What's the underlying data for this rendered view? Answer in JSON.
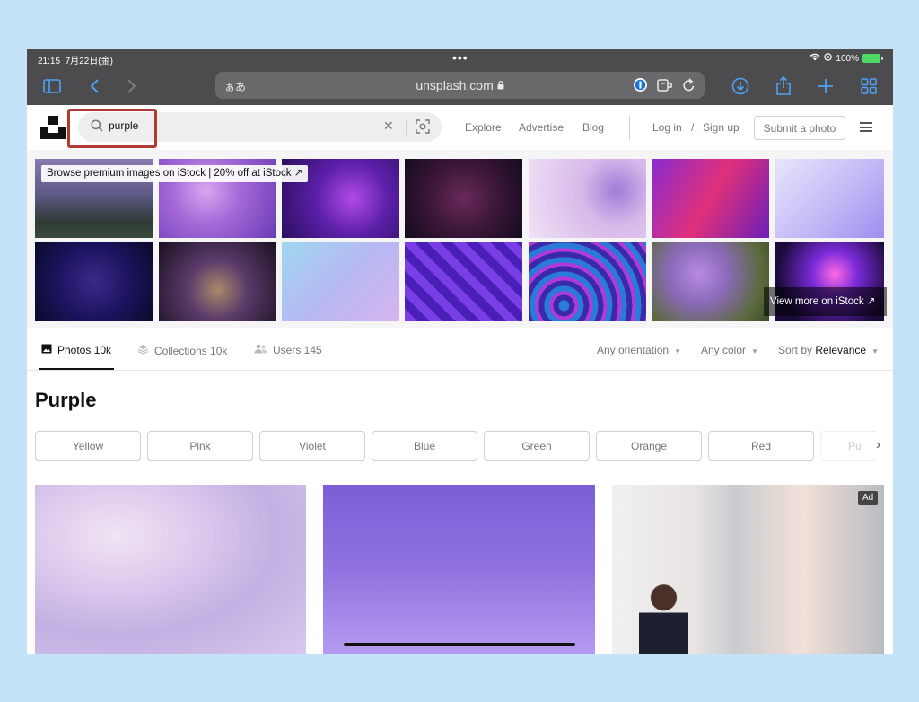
{
  "status": {
    "time": "21:15",
    "date": "7月22日(金)",
    "battery": "100%"
  },
  "browser": {
    "reader_label": "ぁあ",
    "url": "unsplash.com"
  },
  "header": {
    "search_value": "purple",
    "nav": {
      "explore": "Explore",
      "advertise": "Advertise",
      "blog": "Blog",
      "login": "Log in",
      "slash": "/",
      "signup": "Sign up",
      "submit": "Submit a photo"
    }
  },
  "banner": {
    "label": "Browse premium images on iStock | 20% off at iStock ↗",
    "view_more": "View more on iStock ↗"
  },
  "tabs": [
    {
      "label": "Photos 10k"
    },
    {
      "label": "Collections 10k"
    },
    {
      "label": "Users 145"
    }
  ],
  "filters": {
    "orientation": "Any orientation",
    "color": "Any color",
    "sort_prefix": "Sort by",
    "sort_value": "Relevance"
  },
  "title": "Purple",
  "chips": [
    "Yellow",
    "Pink",
    "Violet",
    "Blue",
    "Green",
    "Orange",
    "Red",
    "Pu"
  ],
  "ad_badge": "Ad",
  "colors": {
    "browser_chrome": "#4c4c4e",
    "accent_blue": "#4ea1f6",
    "highlight_red": "#b13a32"
  }
}
